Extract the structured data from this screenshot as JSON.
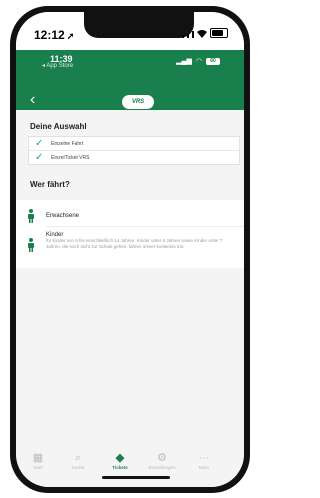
{
  "outer_status": {
    "time": "12:12"
  },
  "inner_status": {
    "time": "11:39",
    "back_label": "◂ App Store",
    "battery": "60"
  },
  "header": {
    "logo": "VRS"
  },
  "selection": {
    "title": "Deine Auswahl",
    "items": [
      "Einzelne Fahrt",
      "EinzelTicket VRS"
    ]
  },
  "who": {
    "title": "Wer fährt?",
    "adult_label": "Erwachsene",
    "child_label": "Kinder",
    "child_desc": "für Kinder von 6 bis einschließlich 14 Jahren. Kinder unter 6 Jahren sowie Kinder unter 7 Jahren, die noch nicht zur Schule gehen, fahren immer kostenlos mit."
  },
  "tabs": [
    {
      "label": "Start",
      "icon": "grid-icon"
    },
    {
      "label": "Suche",
      "icon": "search-icon"
    },
    {
      "label": "Tickets",
      "icon": "ticket-icon"
    },
    {
      "label": "Einstellungen",
      "icon": "gear-icon"
    },
    {
      "label": "Mehr",
      "icon": "more-icon"
    }
  ],
  "active_tab": "Tickets",
  "colors": {
    "accent": "#197f4c",
    "check": "#2aa75c"
  }
}
